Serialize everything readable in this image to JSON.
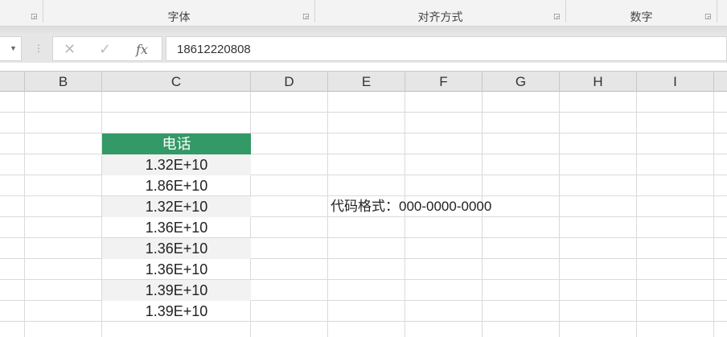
{
  "ribbon": {
    "groups": [
      "字体",
      "对齐方式",
      "数字"
    ]
  },
  "formula_bar": {
    "cancel": "✕",
    "enter": "✓",
    "fx": "fx",
    "value": "18612220808"
  },
  "columns": [
    "B",
    "C",
    "D",
    "E",
    "F",
    "G",
    "H",
    "I"
  ],
  "table": {
    "header": "电话",
    "values": [
      "1.32E+10",
      "1.86E+10",
      "1.32E+10",
      "1.36E+10",
      "1.36E+10",
      "1.36E+10",
      "1.39E+10",
      "1.39E+10"
    ]
  },
  "note": "代码格式：000-0000-0000",
  "colors": {
    "header_green": "#339966",
    "stripe": "#f2f2f2"
  }
}
